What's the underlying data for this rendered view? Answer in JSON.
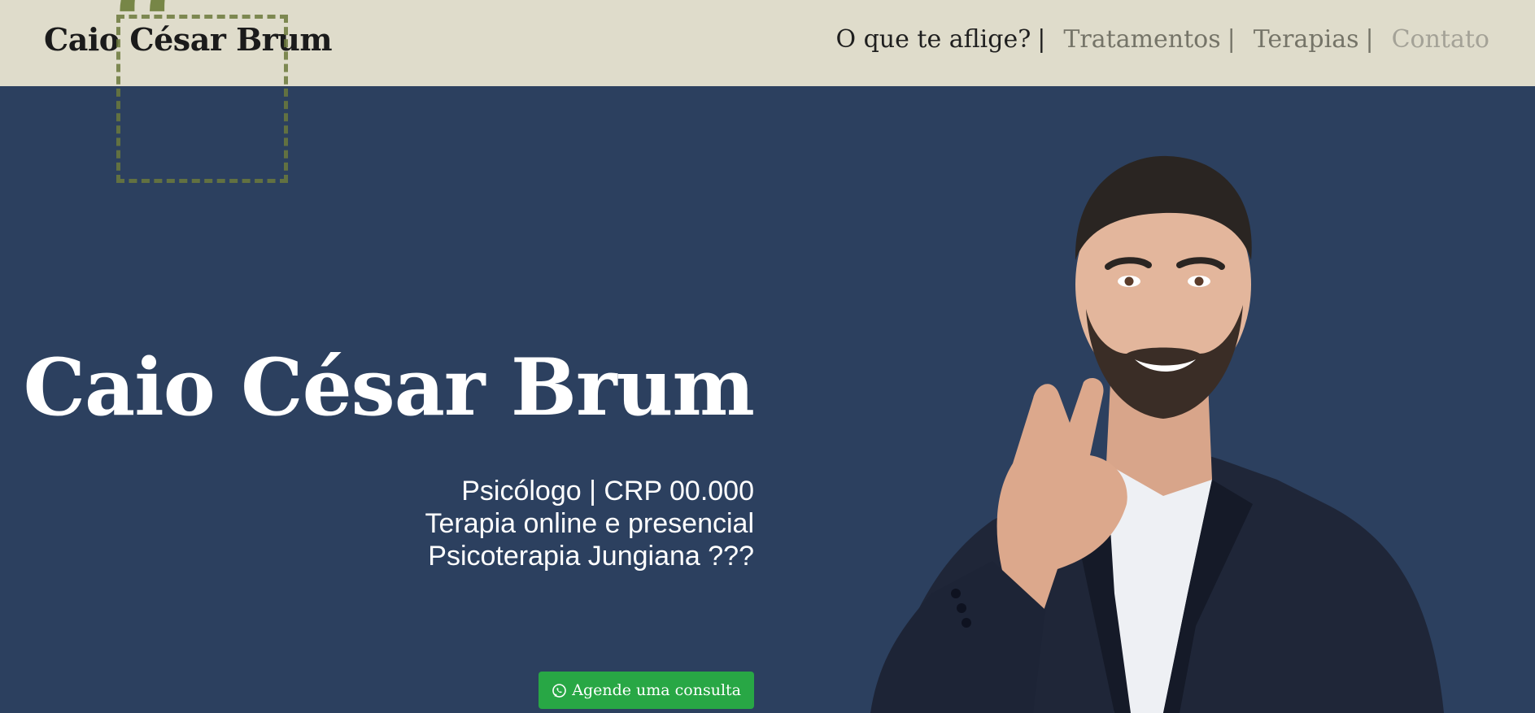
{
  "header": {
    "brand": "Caio César Brum",
    "nav": [
      {
        "label": "O que te aflige?",
        "sep": "|"
      },
      {
        "label": "Tratamentos",
        "sep": "|"
      },
      {
        "label": "Terapias",
        "sep": "|"
      },
      {
        "label": "Contato"
      }
    ]
  },
  "decor": {
    "quote_glyph": "“",
    "quote_icon": "quote-icon"
  },
  "hero": {
    "title": "Caio César Brum",
    "line1": "Psicólogo | CRP 00.000",
    "line2": "Terapia online e presencial",
    "line3": "Psicoterapia Jungiana ???",
    "cta_label": "Agende uma consulta",
    "cta_icon": "whatsapp-icon",
    "portrait_icon": "portrait-photo"
  },
  "colors": {
    "header_bg": "#dfdccb",
    "hero_bg": "#2c405f",
    "accent_olive": "#6f7f3c",
    "cta_green": "#28a745"
  }
}
